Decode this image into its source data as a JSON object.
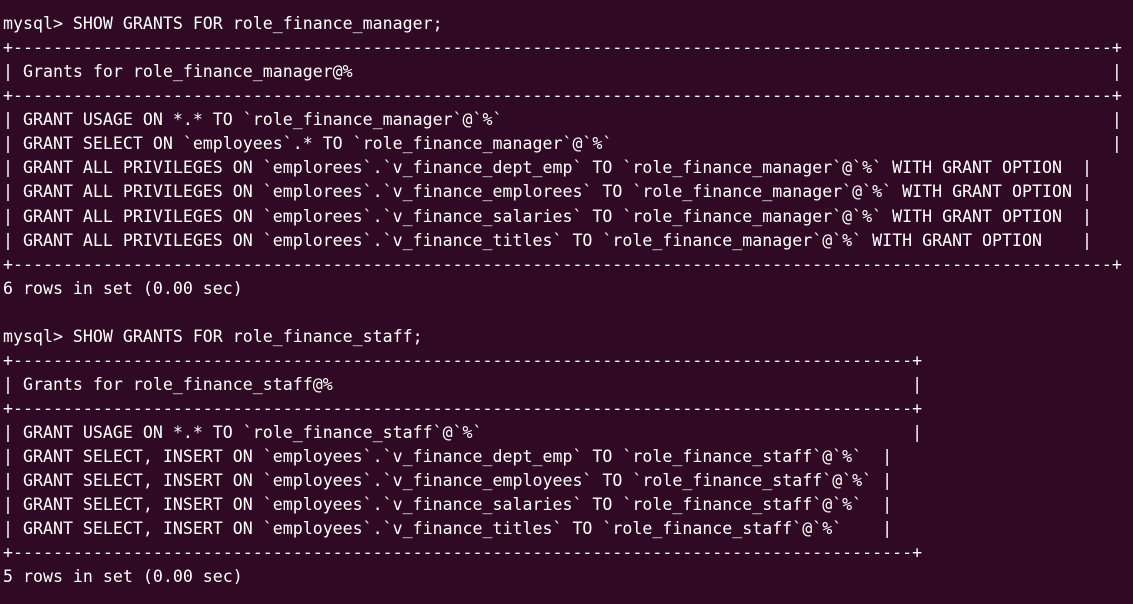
{
  "terminal": {
    "lines": [
      {
        "kind": "command",
        "text": "mysql> SHOW GRANTS FOR role_finance_manager;"
      },
      {
        "kind": "border",
        "text": "+--------------------------------------------------------------------------------------------------------------+"
      },
      {
        "kind": "header",
        "text": "| Grants for role_finance_manager@%                                                                            |"
      },
      {
        "kind": "border",
        "text": "+--------------------------------------------------------------------------------------------------------------+"
      },
      {
        "kind": "row",
        "text": "| GRANT USAGE ON *.* TO `role_finance_manager`@`%`                                                             |"
      },
      {
        "kind": "row",
        "text": "| GRANT SELECT ON `employees`.* TO `role_finance_manager`@`%`                                                  |"
      },
      {
        "kind": "row",
        "text": "| GRANT ALL PRIVILEGES ON `emplorees`.`v_finance_dept_emp` TO `role_finance_manager`@`%` WITH GRANT OPTION  |"
      },
      {
        "kind": "row",
        "text": "| GRANT ALL PRIVILEGES ON `emplorees`.`v_finance_emplorees` TO `role_finance_manager`@`%` WITH GRANT OPTION |"
      },
      {
        "kind": "row",
        "text": "| GRANT ALL PRIVILEGES ON `emplorees`.`v_finance_salaries` TO `role_finance_manager`@`%` WITH GRANT OPTION  |"
      },
      {
        "kind": "row",
        "text": "| GRANT ALL PRIVILEGES ON `emplorees`.`v_finance_titles` TO `role_finance_manager`@`%` WITH GRANT OPTION    |"
      },
      {
        "kind": "border",
        "text": "+--------------------------------------------------------------------------------------------------------------+"
      },
      {
        "kind": "status",
        "text": "6 rows in set (0.00 sec)"
      },
      {
        "kind": "blank",
        "text": ""
      },
      {
        "kind": "command",
        "text": "mysql> SHOW GRANTS FOR role_finance_staff;"
      },
      {
        "kind": "border",
        "text": "+------------------------------------------------------------------------------------------+"
      },
      {
        "kind": "header",
        "text": "| Grants for role_finance_staff@%                                                          |"
      },
      {
        "kind": "border",
        "text": "+------------------------------------------------------------------------------------------+"
      },
      {
        "kind": "row",
        "text": "| GRANT USAGE ON *.* TO `role_finance_staff`@`%`                                           |"
      },
      {
        "kind": "row",
        "text": "| GRANT SELECT, INSERT ON `employees`.`v_finance_dept_emp` TO `role_finance_staff`@`%`  |"
      },
      {
        "kind": "row",
        "text": "| GRANT SELECT, INSERT ON `employees`.`v_finance_employees` TO `role_finance_staff`@`%` |"
      },
      {
        "kind": "row",
        "text": "| GRANT SELECT, INSERT ON `employees`.`v_finance_salaries` TO `role_finance_staff`@`%`  |"
      },
      {
        "kind": "row",
        "text": "| GRANT SELECT, INSERT ON `employees`.`v_finance_titles` TO `role_finance_staff`@`%`    |"
      },
      {
        "kind": "border",
        "text": "+------------------------------------------------------------------------------------------+"
      },
      {
        "kind": "status",
        "text": "5 rows in set (0.00 sec)"
      }
    ]
  },
  "colors": {
    "background": "#300a24",
    "foreground": "#ffffff"
  }
}
